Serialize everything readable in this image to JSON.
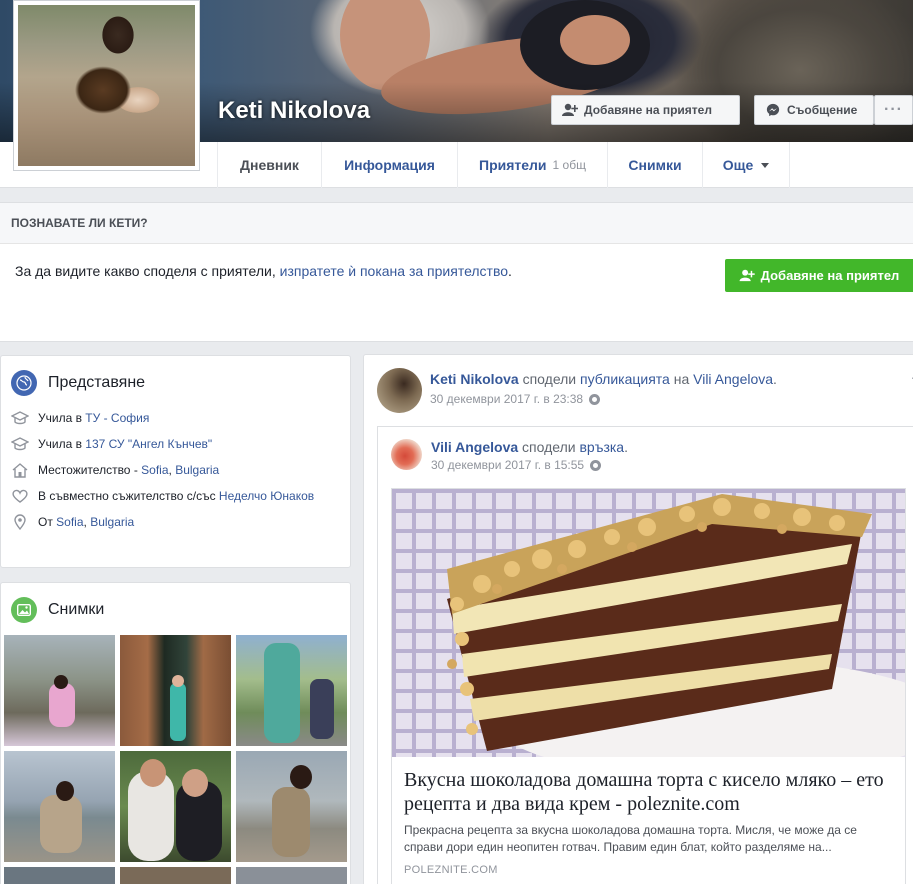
{
  "profile": {
    "name": "Keti Nikolova",
    "add_friend_label": "Добавяне на приятел",
    "message_label": "Съобщение",
    "more_label": "···"
  },
  "nav": {
    "tabs": [
      {
        "label": "Дневник"
      },
      {
        "label": "Информация"
      },
      {
        "label": "Приятели",
        "count": "1 общ"
      },
      {
        "label": "Снимки"
      },
      {
        "label": "Още"
      }
    ]
  },
  "know": {
    "header": "ПОЗНАВАТЕ ЛИ КЕТИ?",
    "text": "За да видите какво споделя с приятели, ",
    "link": "изпратете ѝ покана за приятелство",
    "suffix": ".",
    "button_label": "Добавяне на приятел"
  },
  "intro": {
    "title": "Представяне",
    "rows": [
      {
        "prefix": "Учила в ",
        "link": "ТУ - София",
        "rest": ""
      },
      {
        "prefix": "Учила в ",
        "link": "137 СУ \"Ангел Кънчев\"",
        "rest": ""
      },
      {
        "prefix": "Местожителство - ",
        "link": "Sofia",
        "sep": ", ",
        "link2": "Bulgaria"
      },
      {
        "prefix": "В съвместно съжителство с/със ",
        "link": "Неделчо Юнаков"
      },
      {
        "prefix": "От ",
        "link": "Sofia",
        "sep": ", ",
        "link2": "Bulgaria"
      }
    ]
  },
  "photos": {
    "title": "Снимки"
  },
  "post": {
    "author": "Keti Nikolova",
    "action": " сподели ",
    "object": "публикацията",
    "on": " на ",
    "target": "Vili Angelova",
    "end": ".",
    "time": "30 декември 2017 г. в 23:38",
    "shared": {
      "author": "Vili Angelova",
      "action": " сподели ",
      "object": "връзка",
      "end": ".",
      "time": "30 декември 2017 г. в 15:55"
    },
    "link": {
      "title": "Вкусна шоколадова домашна торта с кисело мляко – ето рецепта и два вида крем - poleznite.com",
      "description": "Прекрасна рецепта за вкусна шоколадова домашна торта. Мисля, че може да се справи дори един неопитен готвач. Правим един блат, който разделяме на...",
      "domain": "POLEZNITE.COM"
    }
  },
  "colors": {
    "link": "#365899",
    "green": "#42b72a",
    "background": "#e9ebee"
  }
}
